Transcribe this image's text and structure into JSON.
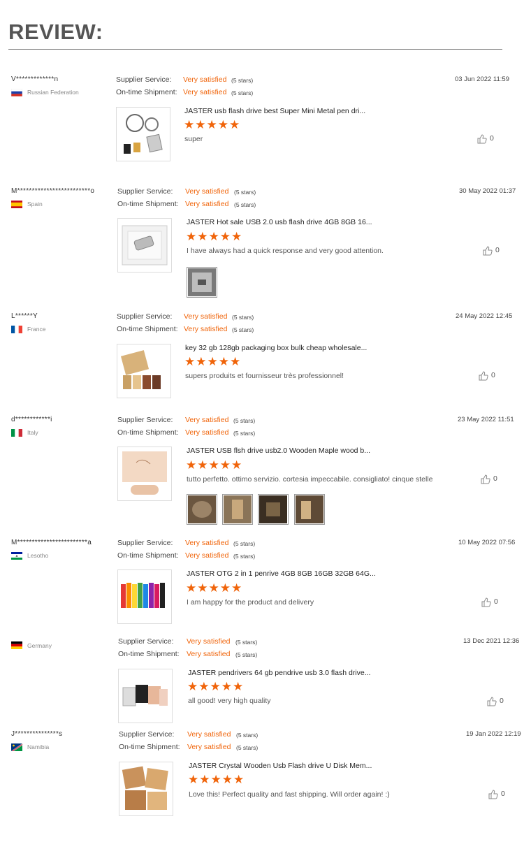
{
  "page": {
    "title": "REVIEW:"
  },
  "labels": {
    "supplier": "Supplier Service:",
    "shipment": "On-time Shipment:",
    "stars_glyph": "★★★★★"
  },
  "colors": {
    "accent": "#f0640a",
    "text": "#333333",
    "muted": "#888888"
  },
  "reviews": [
    {
      "user": "V*************n",
      "country": "Russian Federation",
      "flag": "russia",
      "supplier_value": "Very satisfied",
      "supplier_count": "(5 stars)",
      "shipment_value": "Very satisfied",
      "shipment_count": "(5 stars)",
      "date": "03 Jun 2022 11:59",
      "product_title": "JASTER usb flash drive best Super Mini Metal pen dri...",
      "rating": 5,
      "comment": "super",
      "likes": "0",
      "photos": 0
    },
    {
      "user": "M*************************o",
      "country": "Spain",
      "flag": "spain",
      "supplier_value": "Very satisfied",
      "supplier_count": "(5 stars)",
      "shipment_value": "Very satisfied",
      "shipment_count": "(5 stars)",
      "date": "30 May 2022 01:37",
      "product_title": "JASTER Hot sale USB 2.0 usb flash drive 4GB 8GB 16...",
      "rating": 5,
      "comment": "I have always had a quick response and very good attention.",
      "likes": "0",
      "photos": 1
    },
    {
      "user": "L******Y",
      "country": "France",
      "flag": "france",
      "supplier_value": "Very satisfied",
      "supplier_count": "(5 stars)",
      "shipment_value": "Very satisfied",
      "shipment_count": "(5 stars)",
      "date": "24 May 2022 12:45",
      "product_title": "key 32 gb 128gb packaging box bulk cheap wholesale...",
      "rating": 5,
      "comment": "supers produits et fournisseur très professionnel!",
      "likes": "0",
      "photos": 0
    },
    {
      "user": "d************i",
      "country": "Italy",
      "flag": "italy",
      "supplier_value": "Very satisfied",
      "supplier_count": "(5 stars)",
      "shipment_value": "Very satisfied",
      "shipment_count": "(5 stars)",
      "date": "23 May 2022 11:51",
      "product_title": "JASTER USB flsh drive usb2.0 Wooden Maple wood b...",
      "rating": 5,
      "comment": "tutto perfetto. ottimo servizio. cortesia impeccabile. consigliato! cinque stelle",
      "likes": "0",
      "photos": 4
    },
    {
      "user": "M************************a",
      "country": "Lesotho",
      "flag": "lesotho",
      "supplier_value": "Very satisfied",
      "supplier_count": "(5 stars)",
      "shipment_value": "Very satisfied",
      "shipment_count": "(5 stars)",
      "date": "10 May 2022 07:56",
      "product_title": "JASTER OTG 2 in 1 penrive 4GB 8GB 16GB 32GB 64G...",
      "rating": 5,
      "comment": "I am happy for the product and delivery",
      "likes": "0",
      "photos": 0
    },
    {
      "user": "",
      "country": "Germany",
      "flag": "germany",
      "supplier_value": "Very satisfied",
      "supplier_count": "(5 stars)",
      "shipment_value": "Very satisfied",
      "shipment_count": "(5 stars)",
      "date": "13 Dec 2021 12:36",
      "product_title": "JASTER pendrivers 64 gb pendrive usb 3.0 flash drive...",
      "rating": 5,
      "comment": "all good! very high quality",
      "likes": "0",
      "photos": 0
    },
    {
      "user": "J***************s",
      "country": "Namibia",
      "flag": "namibia",
      "supplier_value": "Very satisfied",
      "supplier_count": "(5 stars)",
      "shipment_value": "Very satisfied",
      "shipment_count": "(5 stars)",
      "date": "19 Jan 2022 12:19",
      "product_title": "JASTER Crystal Wooden Usb Flash drive U Disk Mem...",
      "rating": 5,
      "comment": "Love this! Perfect quality and fast shipping. Will order again! :)",
      "likes": "0",
      "photos": 0
    }
  ]
}
